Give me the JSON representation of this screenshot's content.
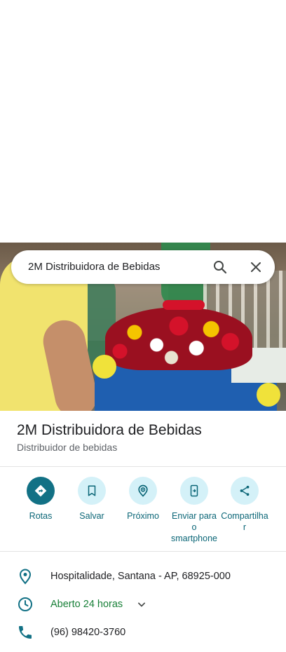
{
  "search": {
    "query": "2M Distribuidora de Bebidas",
    "search_icon": "search-icon",
    "close_icon": "close-icon"
  },
  "place": {
    "name": "2M Distribuidora de Bebidas",
    "category": "Distribuidor de bebidas"
  },
  "actions": [
    {
      "label": "Rotas",
      "icon": "directions-icon"
    },
    {
      "label": "Salvar",
      "icon": "bookmark-icon"
    },
    {
      "label": "Próximo",
      "icon": "nearby-icon"
    },
    {
      "label_lines": [
        "Enviar para",
        "o",
        "smartphone"
      ],
      "icon": "send-to-phone-icon"
    },
    {
      "label_lines": [
        "Compartilha",
        "r"
      ],
      "icon": "share-icon"
    }
  ],
  "info": {
    "address": "Hospitalidade, Santana - AP, 68925-000",
    "hours": "Aberto 24 horas",
    "phone": "(96) 98420-3760"
  },
  "colors": {
    "accent": "#127185",
    "accent_light": "#d4f1f8",
    "open_green": "#188038"
  }
}
